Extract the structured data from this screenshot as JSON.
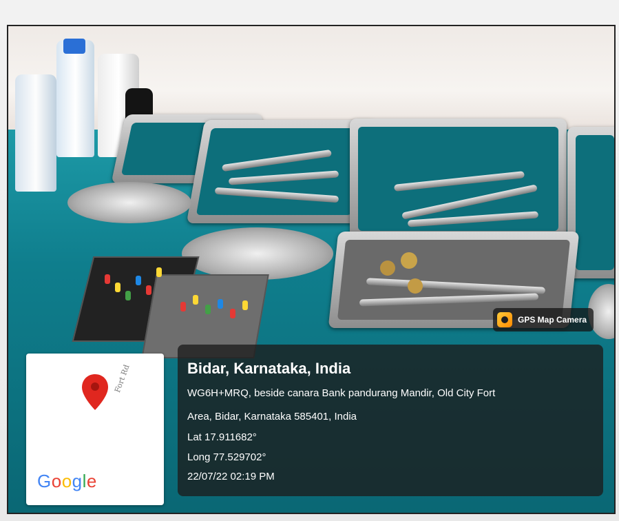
{
  "overlay": {
    "app_name": "GPS Map Camera",
    "app_icon": "camera-pin-icon"
  },
  "map_card": {
    "pin_icon": "map-pin-icon",
    "road_label": "Fort Rd",
    "brand": "Google",
    "brand_colors": [
      "#4285F4",
      "#EA4335",
      "#FBBC05",
      "#4285F4",
      "#34A853",
      "#EA4335"
    ]
  },
  "location": {
    "title": "Bidar, Karnataka, India",
    "address_line1": "WG6H+MRQ, beside canara Bank pandurang Mandir, Old City Fort",
    "address_line2": "Area, Bidar, Karnataka 585401, India",
    "lat": "Lat 17.911682°",
    "long": "Long 77.529702°",
    "datetime": "22/07/22 02:19 PM"
  },
  "colors": {
    "cloth": "#0f7e8d",
    "tray": "#b5b5b5",
    "pin": "#e0271f"
  }
}
